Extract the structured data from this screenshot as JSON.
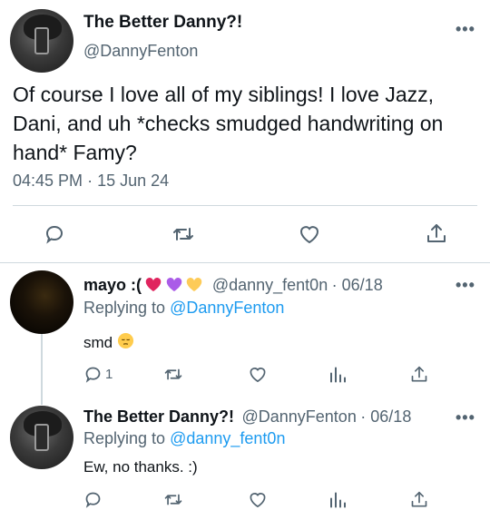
{
  "main_tweet": {
    "name": "The Better Danny?!",
    "handle": "@DannyFenton",
    "text": "Of course I love all of my siblings! I love Jazz, Dani, and uh *checks smudged handwriting on hand* Famy?",
    "time": "04:45 PM",
    "date": "15 Jun 24",
    "more": "•••",
    "icons": [
      "reply-icon",
      "retweet-icon",
      "like-icon",
      "share-icon"
    ]
  },
  "replies": [
    {
      "name": "mayo :(",
      "name_emojis": [
        "red-heart-icon",
        "purple-heart-icon",
        "yellow-heart-icon"
      ],
      "handle": "@danny_fent0n",
      "date": "06/18",
      "replying_to_label": "Replying to",
      "replying_to": "@DannyFenton",
      "text": "smd",
      "text_emoji": "pensive-face-icon",
      "reply_count": "1",
      "more": "•••"
    },
    {
      "name": "The Better Danny?!",
      "handle": "@DannyFenton",
      "date": "06/18",
      "replying_to_label": "Replying to",
      "replying_to": "@danny_fent0n",
      "text": "Ew, no thanks. :)",
      "more": "•••"
    }
  ],
  "colors": {
    "text": "#0f1419",
    "secondary": "#536471",
    "link": "#1d9bf0",
    "divider": "#cfd9de"
  }
}
